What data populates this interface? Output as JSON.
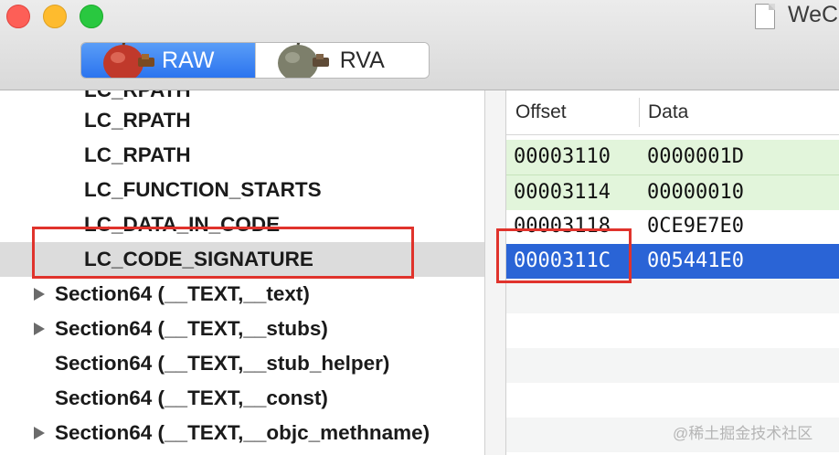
{
  "window": {
    "title": "WeC",
    "view_modes": [
      {
        "label": "RAW",
        "selected": true
      },
      {
        "label": "RVA",
        "selected": false
      }
    ]
  },
  "tree": {
    "items": [
      {
        "label": "LC_RPATH",
        "expandable": false,
        "selected": false,
        "partially_visible": true
      },
      {
        "label": "LC_RPATH",
        "expandable": false,
        "selected": false
      },
      {
        "label": "LC_RPATH",
        "expandable": false,
        "selected": false
      },
      {
        "label": "LC_FUNCTION_STARTS",
        "expandable": false,
        "selected": false
      },
      {
        "label": "LC_DATA_IN_CODE",
        "expandable": false,
        "selected": false
      },
      {
        "label": "LC_CODE_SIGNATURE",
        "expandable": false,
        "selected": true
      },
      {
        "label": "Section64 (__TEXT,__text)",
        "expandable": true,
        "selected": false
      },
      {
        "label": "Section64 (__TEXT,__stubs)",
        "expandable": true,
        "selected": false
      },
      {
        "label": "Section64 (__TEXT,__stub_helper)",
        "expandable": false,
        "selected": false
      },
      {
        "label": "Section64 (__TEXT,__const)",
        "expandable": false,
        "selected": false
      },
      {
        "label": "Section64 (__TEXT,__objc_methname)",
        "expandable": true,
        "selected": false
      }
    ]
  },
  "table": {
    "columns": [
      "Offset",
      "Data"
    ],
    "rows": [
      {
        "offset": "00003110",
        "data": "0000001D",
        "style": "green"
      },
      {
        "offset": "00003114",
        "data": "00000010",
        "style": "green"
      },
      {
        "offset": "00003118",
        "data": "0CE9E7E0",
        "style": "plain"
      },
      {
        "offset": "0000311C",
        "data": "005441E0",
        "style": "selected"
      }
    ]
  },
  "colors": {
    "selection_blue": "#2a64d6",
    "highlight_green": "#e2f5db",
    "annotation_red": "#e0332c"
  },
  "watermark": "@稀土掘金技术社区"
}
